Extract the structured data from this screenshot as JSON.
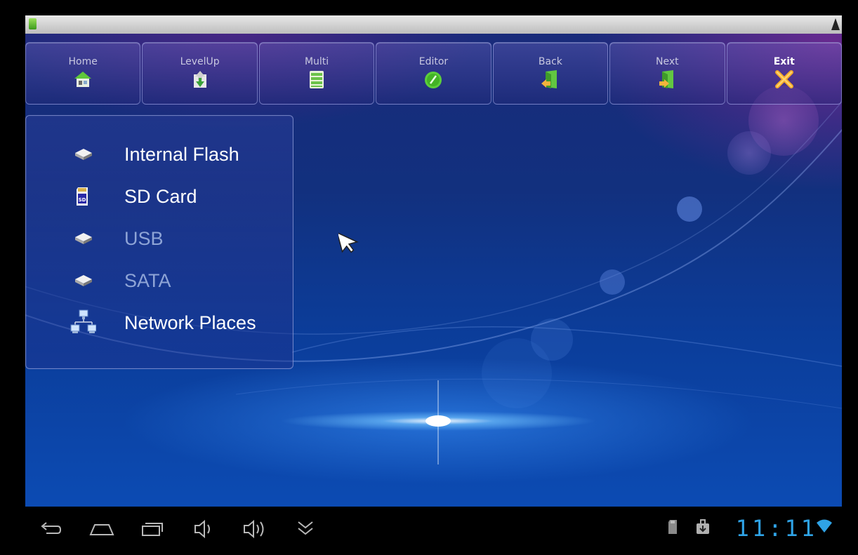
{
  "toolbar": {
    "buttons": [
      {
        "label": "Home",
        "icon": "home-icon"
      },
      {
        "label": "LevelUp",
        "icon": "level-up-icon"
      },
      {
        "label": "Multi",
        "icon": "multi-select-icon"
      },
      {
        "label": "Editor",
        "icon": "editor-icon"
      },
      {
        "label": "Back",
        "icon": "back-icon"
      },
      {
        "label": "Next",
        "icon": "next-icon"
      },
      {
        "label": "Exit",
        "icon": "exit-icon"
      }
    ]
  },
  "storage": {
    "items": [
      {
        "label": "Internal Flash",
        "icon": "drive-icon",
        "enabled": true
      },
      {
        "label": "SD Card",
        "icon": "sd-card-icon",
        "enabled": true
      },
      {
        "label": "USB",
        "icon": "drive-icon",
        "enabled": false
      },
      {
        "label": "SATA",
        "icon": "drive-icon",
        "enabled": false
      },
      {
        "label": "Network Places",
        "icon": "network-icon",
        "enabled": true
      }
    ]
  },
  "system_bar": {
    "time": "11:11",
    "nav_icons": [
      "back-icon",
      "home-icon",
      "recent-apps-icon",
      "volume-down-icon",
      "volume-up-icon",
      "expand-icon"
    ],
    "status_icons": [
      "sd-card-status-icon",
      "download-icon",
      "wifi-icon"
    ]
  },
  "colors": {
    "clock": "#2fa3e6",
    "disabled_text": "#8ea4d6"
  }
}
